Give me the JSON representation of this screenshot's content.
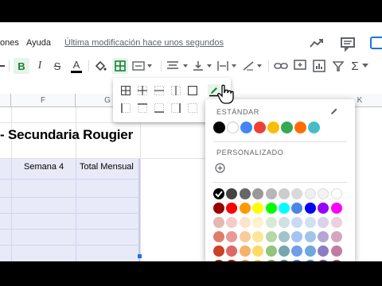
{
  "menu": {
    "items": [
      "ones",
      "Ayuda"
    ],
    "last_edit": "Última modificación hace unos segundos"
  },
  "toolbar": {
    "icons": [
      "paint-format-icon",
      "bold-icon",
      "italic-icon",
      "strikethrough-icon",
      "text-color-icon",
      "fill-color-icon",
      "borders-icon",
      "merge-cells-icon",
      "align-horizontal-icon",
      "align-vertical-icon",
      "text-wrap-icon",
      "text-rotate-icon",
      "link-icon",
      "comment-icon",
      "chart-icon",
      "filter-icon",
      "functions-icon"
    ],
    "bold_label": "B",
    "italic_label": "I",
    "strike_label": "S",
    "textcolor_label": "A",
    "functions_label": "Σ"
  },
  "sheet": {
    "columns": [
      {
        "label": ""
      },
      {
        "label": "F"
      },
      {
        "label": "G"
      },
      {
        "label": "K"
      }
    ],
    "title": "- Secundaria Rougier",
    "header_row": [
      "Semana 4",
      "Total Mensual"
    ]
  },
  "color_picker": {
    "standard_label": "ESTÁNDAR",
    "custom_label": "PERSONALIZADO",
    "standard_colors": [
      "#000000",
      "#ffffff",
      "#4285f4",
      "#ea4335",
      "#fbbc04",
      "#34a853",
      "#ff6d01",
      "#46bdc6"
    ],
    "palette_rows": [
      [
        "#000000",
        "#434343",
        "#666666",
        "#999999",
        "#b7b7b7",
        "#cccccc",
        "#d9d9d9",
        "#efefef",
        "#f3f3f3",
        "#ffffff"
      ],
      [
        "#980000",
        "#ff0000",
        "#ff9900",
        "#ffff00",
        "#00ff00",
        "#00ffff",
        "#4a86e8",
        "#0000ff",
        "#9900ff",
        "#ff00ff"
      ],
      [
        "#e6b8af",
        "#f4cccc",
        "#fce5cd",
        "#fff2cc",
        "#d9ead3",
        "#d0e0e3",
        "#c9daf8",
        "#cfe2f3",
        "#d9d2e9",
        "#ead1dc"
      ],
      [
        "#dd7e6b",
        "#ea9999",
        "#f9cb9c",
        "#ffe599",
        "#b6d7a8",
        "#a2c4c9",
        "#a4c2f4",
        "#9fc5e8",
        "#b4a7d6",
        "#d5a6bd"
      ],
      [
        "#cc4125",
        "#e06666",
        "#f6b26b",
        "#ffd966",
        "#93c47d",
        "#76a5af",
        "#6d9eeb",
        "#6fa8dc",
        "#8e7cc3",
        "#c27ba0"
      ],
      [
        "#a61c00",
        "#cc0000",
        "#e69138",
        "#f1c232",
        "#6aa84f",
        "#45818e",
        "#3c78d8",
        "#3d85c6",
        "#674ea7",
        "#a64d79"
      ]
    ]
  }
}
